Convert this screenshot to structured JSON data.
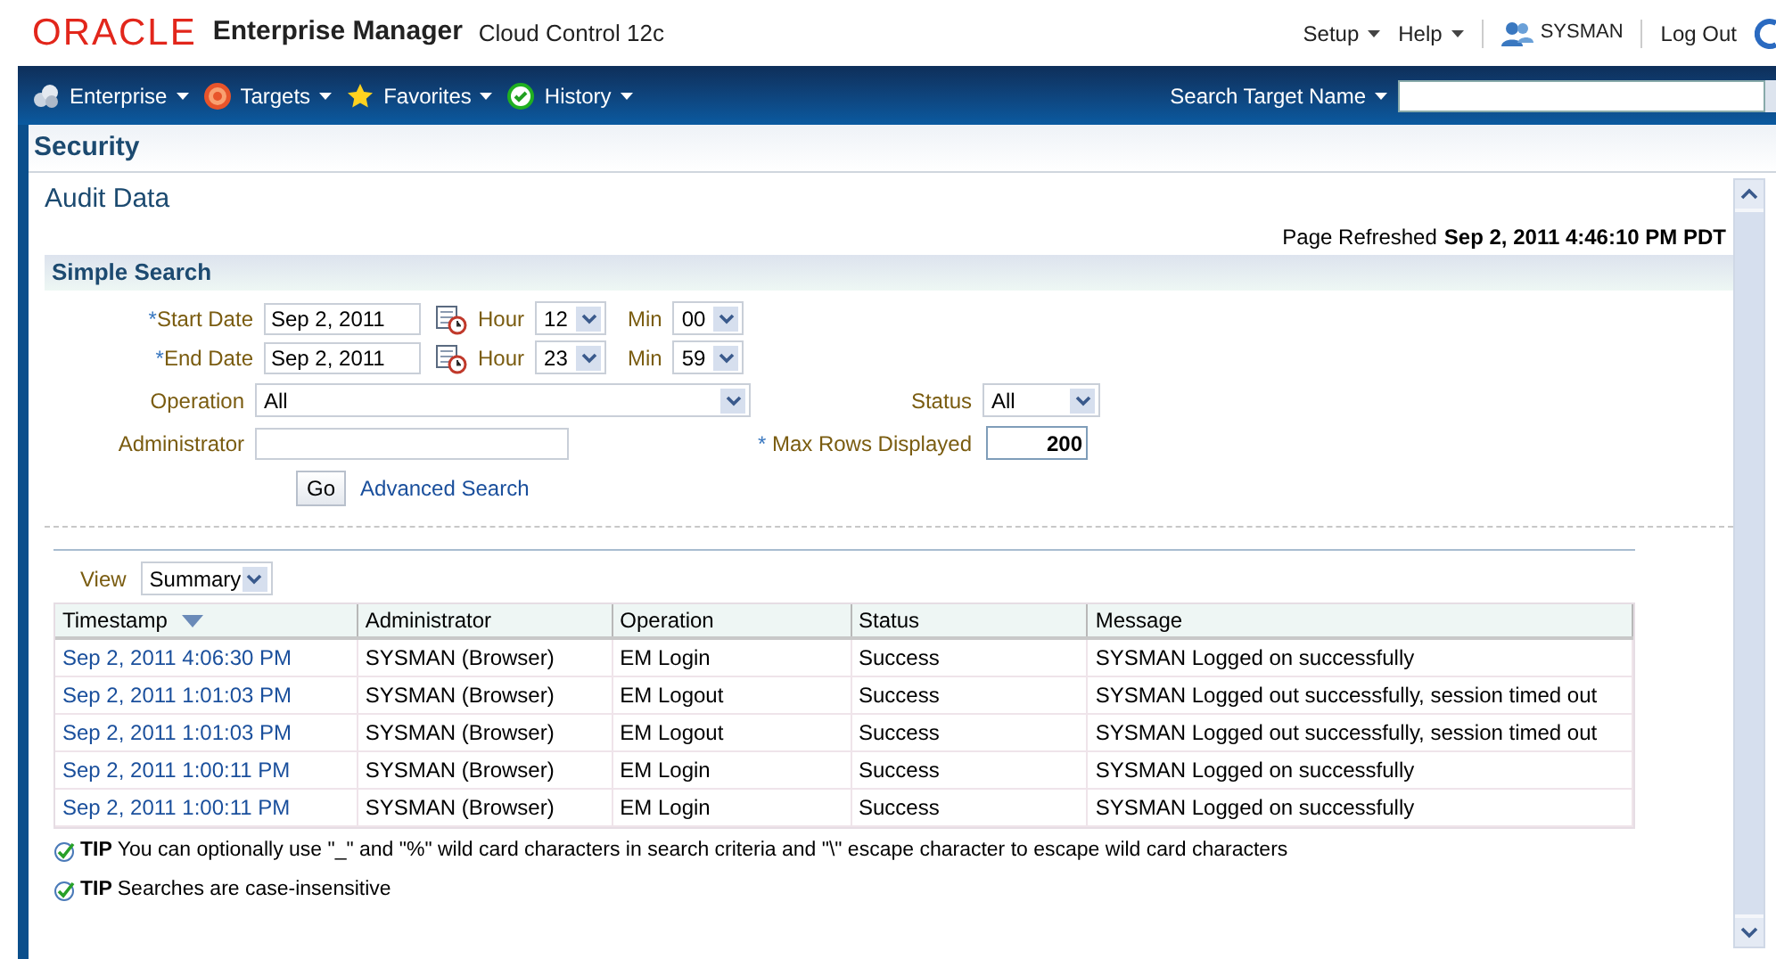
{
  "header": {
    "logo": "ORACLE",
    "product": "Enterprise Manager",
    "edition": "Cloud Control 12c",
    "menus": [
      "Setup",
      "Help"
    ],
    "user": "SYSMAN",
    "logout": "Log Out"
  },
  "nav": {
    "items": [
      {
        "label": "Enterprise",
        "kind": "cloud"
      },
      {
        "label": "Targets",
        "kind": "target"
      },
      {
        "label": "Favorites",
        "kind": "star"
      },
      {
        "label": "History",
        "kind": "check"
      }
    ],
    "search_label": "Search Target Name"
  },
  "page_title": "Security",
  "section_title": "Audit Data",
  "refreshed": {
    "label": "Page Refreshed",
    "value": "Sep 2, 2011 4:46:10 PM PDT"
  },
  "search": {
    "title": "Simple Search",
    "dates": [
      {
        "marker": "*",
        "label": "Start Date",
        "value": "Sep 2, 2011",
        "hour_label": "Hour",
        "hour": "12",
        "min_label": "Min",
        "min": "00"
      },
      {
        "marker": "*",
        "label": "End Date",
        "value": "Sep 2, 2011",
        "hour_label": "Hour",
        "hour": "23",
        "min_label": "Min",
        "min": "59"
      }
    ],
    "operation": {
      "label": "Operation",
      "value": "All"
    },
    "status": {
      "label": "Status",
      "value": "All"
    },
    "administrator": {
      "label": "Administrator"
    },
    "max_rows": {
      "marker": "*",
      "label": "Max Rows Displayed",
      "value": "200"
    },
    "go": "Go",
    "advanced": "Advanced Search"
  },
  "view": {
    "label": "View",
    "value": "Summary"
  },
  "table": {
    "columns": [
      {
        "label": "Timestamp",
        "sorted": true
      },
      {
        "label": "Administrator",
        "sorted": false
      },
      {
        "label": "Operation",
        "sorted": false
      },
      {
        "label": "Status",
        "sorted": false
      },
      {
        "label": "Message",
        "sorted": false
      }
    ],
    "rows": [
      [
        "Sep 2, 2011 4:06:30 PM",
        "SYSMAN (Browser)",
        "EM Login",
        "Success",
        "SYSMAN Logged on successfully"
      ],
      [
        "Sep 2, 2011 1:01:03 PM",
        "SYSMAN (Browser)",
        "EM Logout",
        "Success",
        "SYSMAN Logged out successfully, session timed out"
      ],
      [
        "Sep 2, 2011 1:01:03 PM",
        "SYSMAN (Browser)",
        "EM Logout",
        "Success",
        "SYSMAN Logged out successfully, session timed out"
      ],
      [
        "Sep 2, 2011 1:00:11 PM",
        "SYSMAN (Browser)",
        "EM Login",
        "Success",
        "SYSMAN Logged on successfully"
      ],
      [
        "Sep 2, 2011 1:00:11 PM",
        "SYSMAN (Browser)",
        "EM Login",
        "Success",
        "SYSMAN Logged on successfully"
      ]
    ]
  },
  "tips": [
    {
      "label": "TIP",
      "text": "You can optionally use \"_\" and \"%\" wild card characters in search criteria and \"\\\" escape character to escape wild card characters"
    },
    {
      "label": "TIP",
      "text": "Searches are case-insensitive"
    }
  ]
}
